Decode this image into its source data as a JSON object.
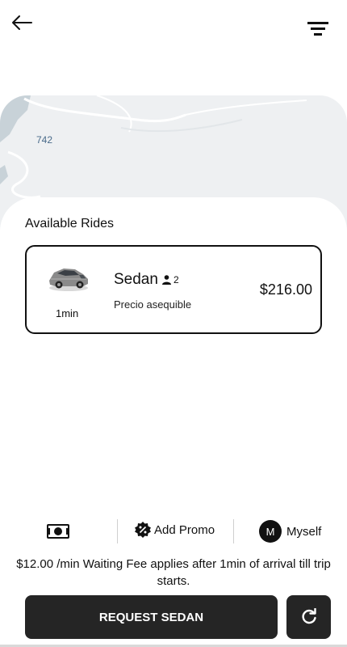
{
  "header": {
    "back_icon": "arrow-left-icon",
    "filter_icon": "filter-icon"
  },
  "map": {
    "road_label": "742"
  },
  "rides": {
    "title": "Available Rides",
    "items": [
      {
        "name": "Sedan",
        "capacity": "2",
        "description": "Precio asequible",
        "price": "$216.00",
        "eta": "1min",
        "icon": "car-icon"
      }
    ]
  },
  "options": {
    "payment_icon": "cash-icon",
    "promo_label": "Add Promo",
    "promo_icon": "promo-badge-icon",
    "rider_initial": "M",
    "rider_label": "Myself"
  },
  "notice": {
    "waiting_fee": "$12.00 /min Waiting Fee applies after 1min of arrival till trip starts."
  },
  "actions": {
    "request_label": "REQUEST SEDAN",
    "refresh_icon": "refresh-icon"
  },
  "colors": {
    "button_bg": "#252525",
    "map_bg": "#eef0f2",
    "map_water": "#c8d2d8"
  }
}
